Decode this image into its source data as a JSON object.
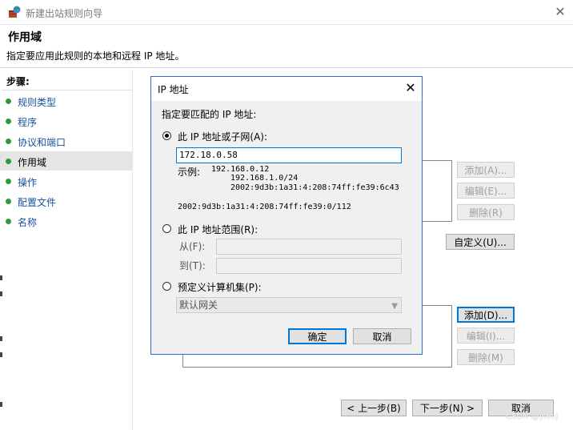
{
  "window": {
    "title": "新建出站规则向导"
  },
  "header": {
    "title": "作用域",
    "description": "指定要应用此规则的本地和远程 IP 地址。"
  },
  "steps": {
    "heading": "步骤:",
    "items": [
      {
        "label": "规则类型"
      },
      {
        "label": "程序"
      },
      {
        "label": "协议和端口"
      },
      {
        "label": "作用域"
      },
      {
        "label": "操作"
      },
      {
        "label": "配置文件"
      },
      {
        "label": "名称"
      }
    ]
  },
  "main": {
    "local_buttons": {
      "add": "添加(A)...",
      "edit": "编辑(E)...",
      "delete": "删除(R)"
    },
    "customize": "自定义(U)...",
    "remote_buttons": {
      "add": "添加(D)...",
      "edit": "编辑(I)...",
      "delete": "删除(M)"
    }
  },
  "footer": {
    "back": "< 上一步(B)",
    "next": "下一步(N) >",
    "cancel": "取消"
  },
  "dialog": {
    "title": "IP 地址",
    "prompt": "指定要匹配的 IP 地址:",
    "option_single": "此 IP 地址或子网(A):",
    "ip_value": "172.18.0.58",
    "example_label": "示例:",
    "examples": [
      "192.168.0.12",
      "192.168.1.0/24",
      "2002:9d3b:1a31:4:208:74ff:fe39:6c43",
      "2002:9d3b:1a31:4:208:74ff:fe39:0/112"
    ],
    "option_range": "此 IP 地址范围(R):",
    "from_label": "从(F):",
    "to_label": "到(T):",
    "option_predefined": "预定义计算机集(P):",
    "predefined_value": "默认网关",
    "ok": "确定",
    "cancel": "取消"
  },
  "watermark": "CSDN @ylehj",
  "colors": {
    "accent": "#0078d7",
    "step_dot": "#2e9b3a",
    "step_link": "#1a50a0"
  }
}
